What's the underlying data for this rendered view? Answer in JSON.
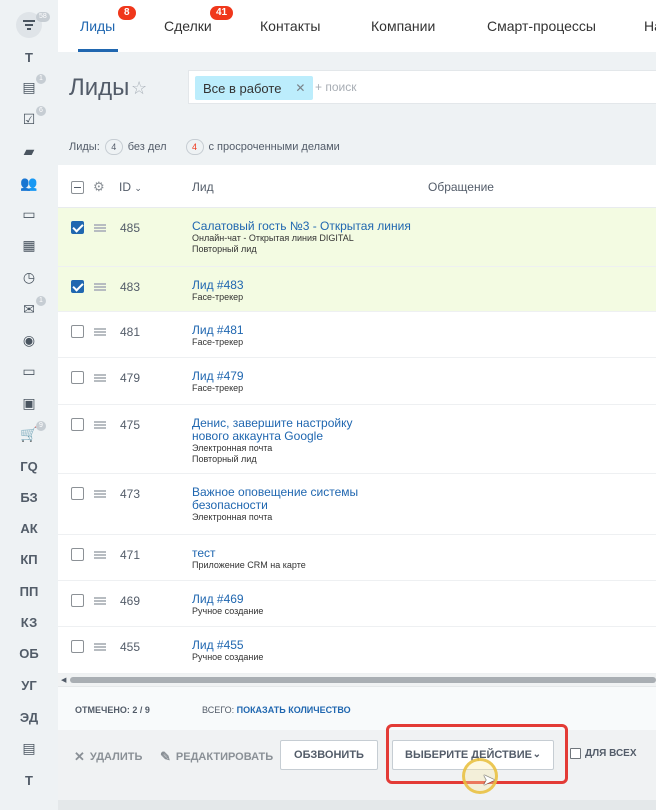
{
  "sidebar": {
    "menu_badge": "58",
    "items": [
      {
        "type": "text",
        "label": "Т"
      },
      {
        "type": "icon",
        "icon": "news-icon",
        "badge": "1"
      },
      {
        "type": "icon",
        "icon": "tasks-icon",
        "badge": "6"
      },
      {
        "type": "icon",
        "icon": "chat-icon"
      },
      {
        "type": "icon",
        "icon": "group-icon"
      },
      {
        "type": "icon",
        "icon": "drive-icon"
      },
      {
        "type": "icon",
        "icon": "calendar-icon"
      },
      {
        "type": "icon",
        "icon": "clock-icon"
      },
      {
        "type": "icon",
        "icon": "mail-icon",
        "badge": "1"
      },
      {
        "type": "icon",
        "icon": "robot-icon"
      },
      {
        "type": "icon",
        "icon": "window-icon"
      },
      {
        "type": "icon",
        "icon": "contact-card-icon"
      },
      {
        "type": "icon",
        "icon": "cart-icon",
        "badge": "9"
      },
      {
        "type": "text",
        "label": "ГQ"
      },
      {
        "type": "text",
        "label": "БЗ"
      },
      {
        "type": "text",
        "label": "АК"
      },
      {
        "type": "text",
        "label": "КП"
      },
      {
        "type": "text",
        "label": "ПП"
      },
      {
        "type": "text",
        "label": "КЗ"
      },
      {
        "type": "text",
        "label": "ОБ"
      },
      {
        "type": "text",
        "label": "УГ"
      },
      {
        "type": "text",
        "label": "ЭД"
      },
      {
        "type": "icon",
        "icon": "document-icon"
      },
      {
        "type": "text",
        "label": "Т"
      }
    ]
  },
  "tabs": [
    {
      "label": "Лиды",
      "badge": "8",
      "active": true
    },
    {
      "label": "Сделки",
      "badge": "41"
    },
    {
      "label": "Контакты"
    },
    {
      "label": "Компании"
    },
    {
      "label": "Смарт-процессы"
    },
    {
      "label": "На"
    }
  ],
  "page": {
    "title": "Лиды",
    "filter_chip": "Все в работе",
    "search_placeholder": "+ поиск"
  },
  "counters": {
    "prefix": "Лиды:",
    "no_tasks_count": "4",
    "no_tasks_label": "без дел",
    "overdue_count": "4",
    "overdue_label": "с просроченными делами"
  },
  "grid": {
    "col_id": "ID",
    "col_lead": "Лид",
    "col_appeal": "Обращение",
    "rows": [
      {
        "id": "485",
        "title": "Салатовый гость №3 - Открытая линия",
        "sub": [
          "Онлайн-чат - Открытая линия DIGITAL",
          "Повторный лид"
        ],
        "checked": true
      },
      {
        "id": "483",
        "title": "Лид #483",
        "sub": [
          "Face-трекер"
        ],
        "checked": true
      },
      {
        "id": "481",
        "title": "Лид #481",
        "sub": [
          "Face-трекер"
        ],
        "checked": false
      },
      {
        "id": "479",
        "title": "Лид #479",
        "sub": [
          "Face-трекер"
        ],
        "checked": false
      },
      {
        "id": "475",
        "title": "Денис, завершите настройку нового аккаунта Google",
        "sub": [
          "Электронная почта",
          "Повторный лид"
        ],
        "checked": false
      },
      {
        "id": "473",
        "title": "Важное оповещение системы безопасности",
        "sub": [
          "Электронная почта"
        ],
        "checked": false
      },
      {
        "id": "471",
        "title": "тест",
        "sub": [
          "Приложение CRM на карте"
        ],
        "checked": false
      },
      {
        "id": "469",
        "title": "Лид #469",
        "sub": [
          "Ручное создание"
        ],
        "checked": false
      },
      {
        "id": "455",
        "title": "Лид #455",
        "sub": [
          "Ручное создание"
        ],
        "checked": false
      }
    ]
  },
  "footer": {
    "selected_label": "Отмечено:",
    "selected_value": "2 / 9",
    "total_label": "Всего:",
    "total_link": "Показать количество"
  },
  "actions": {
    "delete": "Удалить",
    "edit": "Редактировать",
    "call": "Обзвонить",
    "choose_action": "Выберите действие",
    "for_all": "Для всех"
  }
}
